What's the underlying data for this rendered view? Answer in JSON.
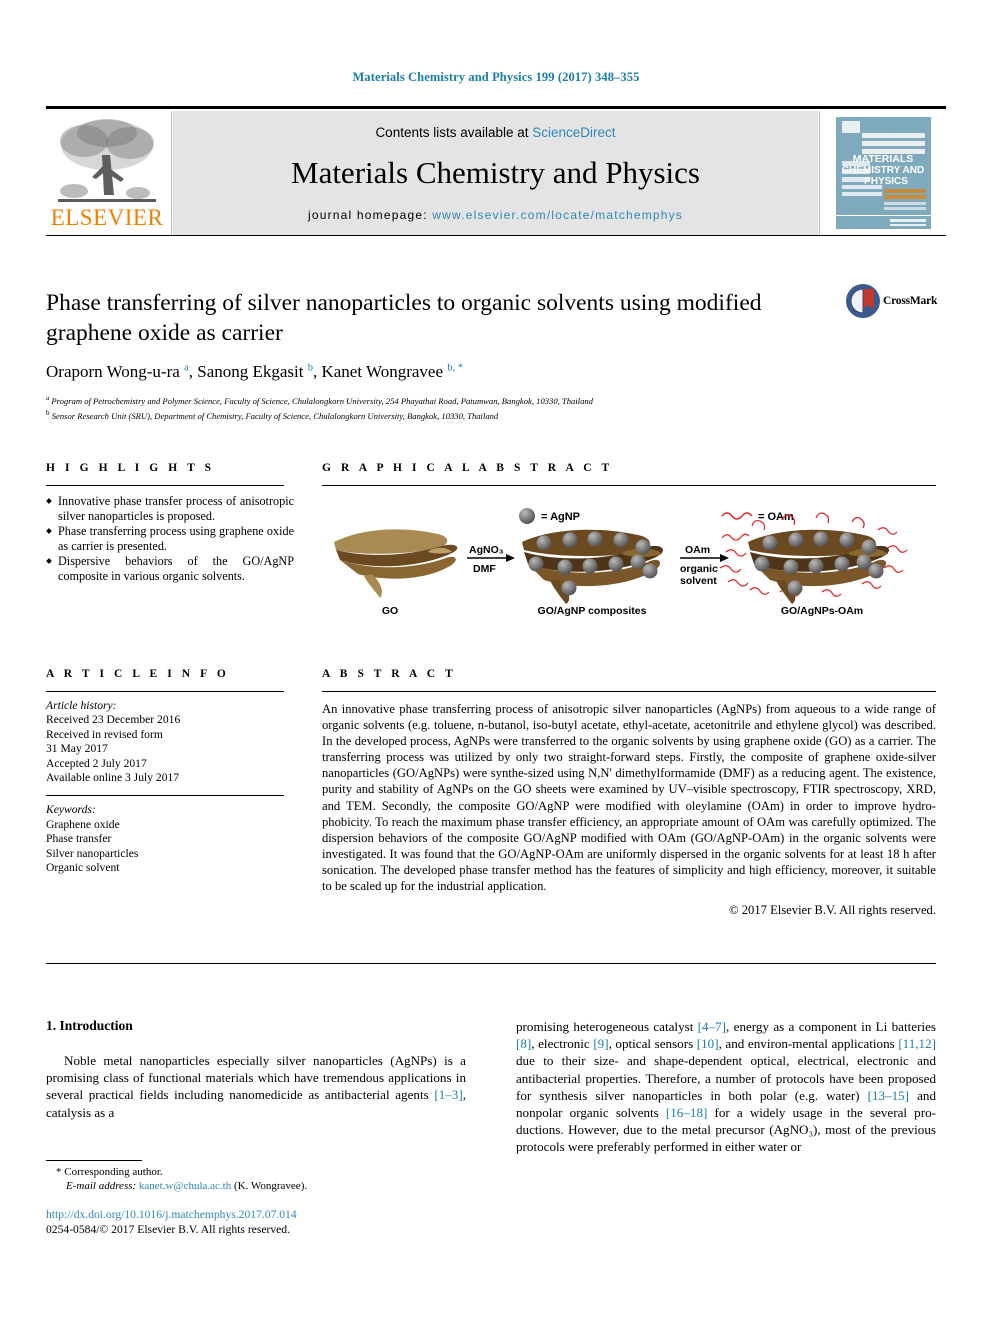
{
  "running_head": "Materials Chemistry and Physics 199 (2017) 348–355",
  "masthead": {
    "contents_prefix": "Contents lists available at ",
    "sciencedirect": "ScienceDirect",
    "journal_title": "Materials Chemistry and Physics",
    "homepage_prefix": "journal homepage: ",
    "homepage_url": "www.elsevier.com/locate/matchemphys",
    "publisher": "ELSEVIER",
    "cover": {
      "line1": "MATERIALS",
      "line2": "CHEMISTRY AND",
      "line3": "PHYSICS"
    },
    "accent_blue": "#2e87b8",
    "elsevier_orange": "#f08000"
  },
  "article": {
    "title": "Phase transferring of silver nanoparticles to organic solvents using modified graphene oxide as carrier",
    "authors_html": "Oraporn Wong-u-ra <sup>a</sup>, Sanong Ekgasit <sup>b</sup>, Kanet Wongravee <sup>b, *</sup>",
    "affiliation_a": "Program of Petrochemistry and Polymer Science, Faculty of Science, Chulalongkorn University, 254 Phayathai Road, Patumwan, Bangkok, 10330, Thailand",
    "affiliation_b": "Sensor Research Unit (SRU), Department of Chemistry, Faculty of Science, Chulalongkorn University, Bangkok, 10330, Thailand",
    "crossmark_label": "CrossMark"
  },
  "highlights": {
    "heading": "H I G H L I G H T S",
    "items": [
      "Innovative phase transfer process of anisotropic silver nanoparticles is proposed.",
      "Phase transferring process using graphene oxide as carrier is presented.",
      "Dispersive behaviors of the GO/AgNP composite in various organic solvents."
    ]
  },
  "graphical_abstract": {
    "heading": "G R A P H I C A L   A B S T R A C T",
    "labels": {
      "stage1": "GO",
      "stage2": "GO/AgNP composites",
      "stage3": "GO/AgNPs-OAm",
      "arrow1_top": "AgNO₃",
      "arrow1_bottom": "DMF",
      "arrow2_top": "OAm",
      "arrow2_bottom_l1": "organic",
      "arrow2_bottom_l2": "solvent",
      "legend_agnp": "= AgNP",
      "legend_oam": "= OAm"
    },
    "colors": {
      "sheet_light": "#a98a52",
      "sheet_dark": "#6b4a22",
      "sheet_mid": "#8a6630",
      "nanoparticle": "#6e6e6e",
      "oam_chain": "#e02020"
    }
  },
  "article_info": {
    "heading": "A R T I C L E   I N F O",
    "history_label": "Article history:",
    "history": [
      "Received 23 December 2016",
      "Received in revised form",
      "31 May 2017",
      "Accepted 2 July 2017",
      "Available online 3 July 2017"
    ],
    "keywords_label": "Keywords:",
    "keywords": [
      "Graphene oxide",
      "Phase transfer",
      "Silver nanoparticles",
      "Organic solvent"
    ]
  },
  "abstract": {
    "heading": "A B S T R A C T",
    "body": "An innovative phase transferring process of anisotropic silver nanoparticles (AgNPs) from aqueous to a wide range of organic solvents (e.g. toluene, n-butanol, iso-butyl acetate, ethyl-acetate, acetonitrile and ethylene glycol) was described. In the developed process, AgNPs were transferred to the organic solvents by using graphene oxide (GO) as a carrier. The transferring process was utilized by only two straight-forward steps. Firstly, the composite of graphene oxide-silver nanoparticles (GO/AgNPs) were synthe-sized using N,N' dimethylformamide (DMF) as a reducing agent. The existence, purity and stability of AgNPs on the GO sheets were examined by UV–visible spectroscopy, FTIR spectroscopy, XRD, and TEM. Secondly, the composite GO/AgNP were modified with oleylamine (OAm) in order to improve hydro-phobicity. To reach the maximum phase transfer efficiency, an appropriate amount of OAm was carefully optimized. The dispersion behaviors of the composite GO/AgNP modified with OAm (GO/AgNP-OAm) in the organic solvents were investigated. It was found that the GO/AgNP-OAm are uniformly dispersed in the organic solvents for at least 18 h after sonication. The developed phase transfer method has the features of simplicity and high efficiency, moreover, it suitable to be scaled up for the industrial application.",
    "copyright": "© 2017 Elsevier B.V. All rights reserved."
  },
  "introduction": {
    "heading": "1. Introduction",
    "left_paragraph_parts": [
      "Noble metal nanoparticles especially silver nanoparticles (AgNPs) is a promising class of functional materials which have tremendous applications in several practical fields including nanomedicide as antibacterial agents ",
      "[1–3]",
      ", catalysis as a"
    ],
    "right_paragraph_parts": [
      "promising heterogeneous catalyst ",
      "[4–7]",
      ", energy as a component in Li batteries ",
      "[8]",
      ", electronic ",
      "[9]",
      ", optical sensors ",
      "[10]",
      ", and environ-mental applications ",
      "[11,12]",
      " due to their size- and shape-dependent optical, electrical, electronic and antibacterial properties. Therefore, a number of protocols have been proposed for synthesis silver nanoparticles in both polar (e.g. water) ",
      "[13–15]",
      " and nonpolar organic solvents ",
      "[16–18]",
      " for a widely usage in the several pro-ductions. However, due to the metal precursor (AgNO₃), most of the previous protocols were preferably performed in either water or"
    ]
  },
  "footer": {
    "corresponding_marker": "*",
    "corresponding_label": "Corresponding author.",
    "email_label": "E-mail address:",
    "email": "kanet.w@chula.ac.th",
    "email_suffix": "(K. Wongravee).",
    "doi_url": "http://dx.doi.org/10.1016/j.matchemphys.2017.07.014",
    "issn_line": "0254-0584/© 2017 Elsevier B.V. All rights reserved."
  }
}
